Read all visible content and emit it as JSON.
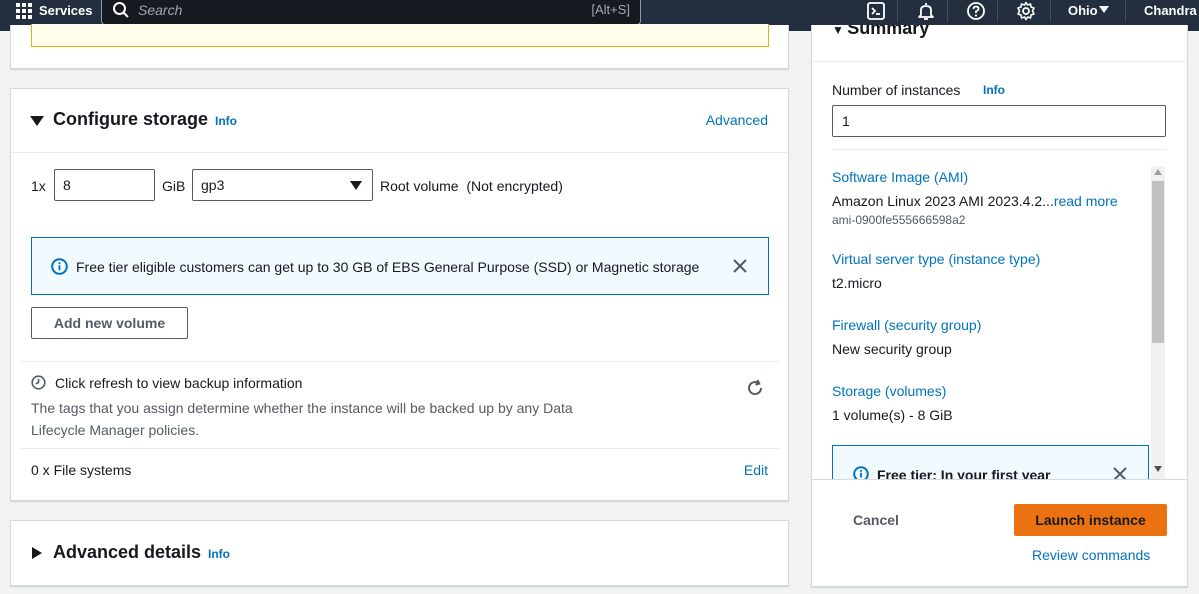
{
  "topnav": {
    "services_label": "Services",
    "search_placeholder": "Search",
    "search_shortcut": "[Alt+S]",
    "region": "Ohio",
    "user": "Chandra s"
  },
  "configure_storage": {
    "title": "Configure storage",
    "info": "Info",
    "advanced": "Advanced",
    "volume_count": "1x",
    "volume_size": "8",
    "unit": "GiB",
    "volume_type": "gp3",
    "root_volume_text": "Root volume  (Not encrypted)",
    "free_tier_alert": "Free tier eligible customers can get up to 30 GB of EBS General Purpose (SSD) or Magnetic storage",
    "add_volume_button": "Add new volume",
    "backup_title": "Click refresh to view backup information",
    "backup_description": "The tags that you assign determine whether the instance will be backed up by any Data Lifecycle Manager policies.",
    "file_systems": "0 x File systems",
    "edit": "Edit"
  },
  "advanced_details": {
    "title": "Advanced details",
    "info": "Info"
  },
  "summary": {
    "title": "Summary",
    "num_instances_label": "Number of instances",
    "info": "Info",
    "num_instances_value": "1",
    "software_image_label": "Software Image (AMI)",
    "software_image_value": "Amazon Linux 2023 AMI 2023.4.2...",
    "read_more": "read more",
    "ami_id": "ami-0900fe555666598a2",
    "server_type_label": "Virtual server type (instance type)",
    "server_type_value": "t2.micro",
    "firewall_label": "Firewall (security group)",
    "firewall_value": "New security group",
    "storage_label": "Storage (volumes)",
    "storage_value": "1 volume(s) - 8 GiB",
    "free_tier_text": "Free tier: In your first year",
    "cancel": "Cancel",
    "launch": "Launch instance",
    "review_commands": "Review commands"
  },
  "colors": {
    "nav_bg": "#232f3e",
    "link": "#0073bb",
    "launch_button": "#ec7211",
    "alert_bg": "#f1faff"
  }
}
